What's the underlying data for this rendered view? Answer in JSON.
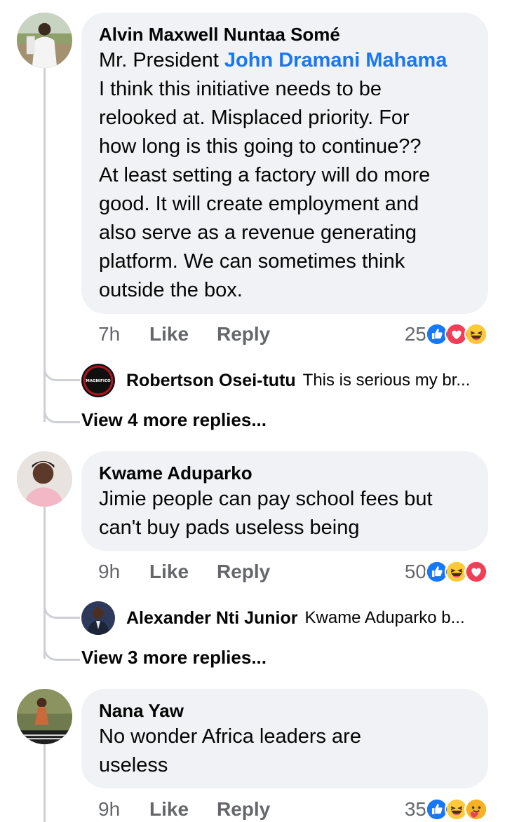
{
  "comments": [
    {
      "author": "Alvin Maxwell Nuntaa Somé",
      "text_prefix": "Mr. President ",
      "mention": "John Dramani Mahama",
      "text_lines": [
        "I think this initiative needs to be",
        "relooked at. Misplaced priority. For",
        "how long is this going to continue??",
        "At least setting a factory will do more",
        "good. It will create employment and",
        "also serve as a revenue generating",
        "platform. We can sometimes think",
        "outside the box."
      ],
      "time": "7h",
      "like_label": "Like",
      "reply_label": "Reply",
      "reaction_count": "25",
      "reactions": [
        "like-reaction-icon",
        "love-reaction-icon",
        "haha-reaction-icon"
      ],
      "reply_preview": {
        "name": "Robertson Osei-tutu",
        "snippet": "This is serious my br...",
        "avatar_text": "MAGNIFICO"
      },
      "view_more": "View 4 more replies..."
    },
    {
      "author": "Kwame Aduparko",
      "text_lines": [
        "Jimie people can pay school fees but",
        "can't buy pads useless being"
      ],
      "time": "9h",
      "like_label": "Like",
      "reply_label": "Reply",
      "reaction_count": "50",
      "reactions": [
        "like-reaction-icon",
        "haha-reaction-icon",
        "love-reaction-icon"
      ],
      "reply_preview": {
        "name": "Alexander Nti Junior",
        "snippet": "Kwame Aduparko b..."
      },
      "view_more": "View 3 more replies..."
    },
    {
      "author": "Nana Yaw",
      "text_lines": [
        "No wonder Africa leaders are",
        "useless"
      ],
      "time": "9h",
      "like_label": "Like",
      "reply_label": "Reply",
      "reaction_count": "35",
      "reactions": [
        "like-reaction-icon",
        "haha-reaction-icon",
        "care-reaction-icon"
      ]
    }
  ],
  "colors": {
    "bubble": "#f0f2f5",
    "mention": "#1877f2",
    "meta": "#65676b",
    "thread_line": "#ced0d4"
  }
}
